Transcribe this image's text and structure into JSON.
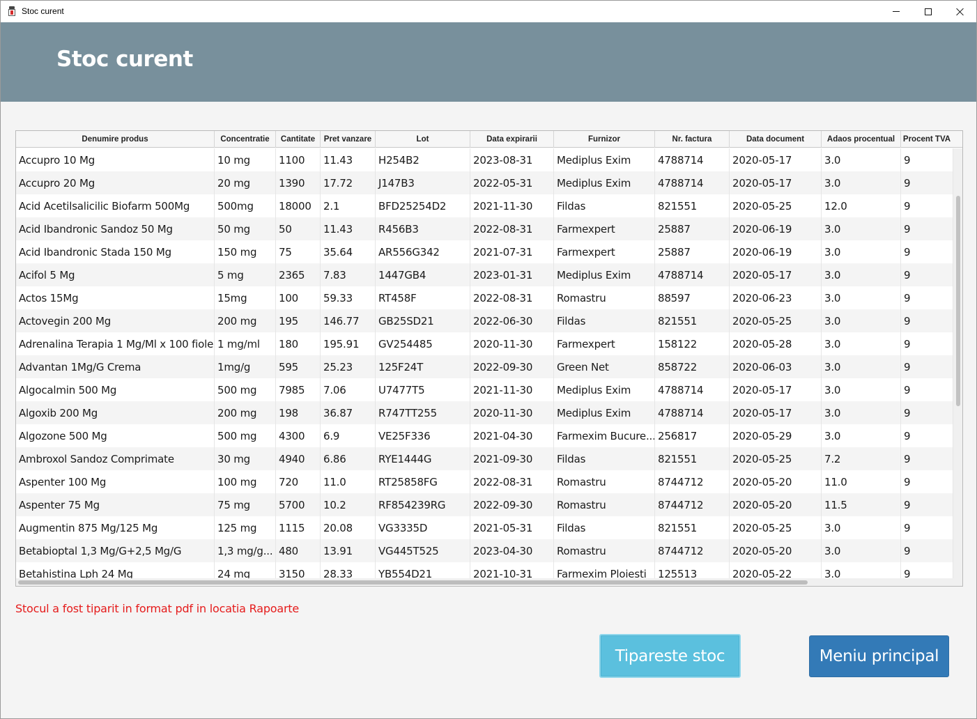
{
  "window": {
    "title": "Stoc curent"
  },
  "header": {
    "title": "Stoc curent",
    "background_color": "#78909c"
  },
  "table": {
    "columns": [
      "Denumire produs",
      "Concentratie",
      "Cantitate",
      "Pret vanzare",
      "Lot",
      "Data expirarii",
      "Furnizor",
      "Nr. factura",
      "Data document",
      "Adaos procentual",
      "Procent TVA"
    ],
    "rows": [
      [
        "Accupro 10 Mg",
        "10 mg",
        "1100",
        "11.43",
        "H254B2",
        "2023-08-31",
        "Mediplus Exim",
        "4788714",
        "2020-05-17",
        "3.0",
        "9"
      ],
      [
        "Accupro 20 Mg",
        "20 mg",
        "1390",
        "17.72",
        "J147B3",
        "2022-05-31",
        "Mediplus Exim",
        "4788714",
        "2020-05-17",
        "3.0",
        "9"
      ],
      [
        "Acid Acetilsalicilic Biofarm 500Mg",
        "500mg",
        "18000",
        "2.1",
        "BFD25254D2",
        "2021-11-30",
        "Fildas",
        "821551",
        "2020-05-25",
        "12.0",
        "9"
      ],
      [
        "Acid Ibandronic Sandoz 50 Mg",
        "50 mg",
        "50",
        "11.43",
        "R456B3",
        "2022-08-31",
        "Farmexpert",
        "25887",
        "2020-06-19",
        "3.0",
        "9"
      ],
      [
        "Acid Ibandronic Stada 150 Mg",
        "150 mg",
        "75",
        "35.64",
        "AR556G342",
        "2021-07-31",
        "Farmexpert",
        "25887",
        "2020-06-19",
        "3.0",
        "9"
      ],
      [
        "Acifol 5 Mg",
        "5 mg",
        "2365",
        "7.83",
        "1447GB4",
        "2023-01-31",
        "Mediplus Exim",
        "4788714",
        "2020-05-17",
        "3.0",
        "9"
      ],
      [
        "Actos 15Mg",
        "15mg",
        "100",
        "59.33",
        "RT458F",
        "2022-08-31",
        "Romastru",
        "88597",
        "2020-06-23",
        "3.0",
        "9"
      ],
      [
        "Actovegin 200 Mg",
        "200 mg",
        "195",
        "146.77",
        "GB25SD21",
        "2022-06-30",
        "Fildas",
        "821551",
        "2020-05-25",
        "3.0",
        "9"
      ],
      [
        "Adrenalina Terapia 1 Mg/Ml x 100 fiole",
        "1 mg/ml",
        "180",
        "195.91",
        "GV254485",
        "2020-11-30",
        "Farmexpert",
        "158122",
        "2020-05-28",
        "3.0",
        "9"
      ],
      [
        "Advantan 1Mg/G Crema",
        "1mg/g",
        "595",
        "25.23",
        "125F24T",
        "2022-09-30",
        "Green Net",
        "858722",
        "2020-06-03",
        "3.0",
        "9"
      ],
      [
        "Algocalmin 500 Mg",
        "500 mg",
        "7985",
        "7.06",
        "U7477T5",
        "2021-11-30",
        "Mediplus Exim",
        "4788714",
        "2020-05-17",
        "3.0",
        "9"
      ],
      [
        "Algoxib 200 Mg",
        "200 mg",
        "198",
        "36.87",
        "R747TT255",
        "2020-11-30",
        "Mediplus Exim",
        "4788714",
        "2020-05-17",
        "3.0",
        "9"
      ],
      [
        "Algozone 500 Mg",
        "500 mg",
        "4300",
        "6.9",
        "VE25F336",
        "2021-04-30",
        "Farmexim Bucure...",
        "256817",
        "2020-05-29",
        "3.0",
        "9"
      ],
      [
        "Ambroxol Sandoz Comprimate",
        "30 mg",
        "4940",
        "6.86",
        "RYE1444G",
        "2021-09-30",
        "Fildas",
        "821551",
        "2020-05-25",
        "7.2",
        "9"
      ],
      [
        "Aspenter 100 Mg",
        "100 mg",
        "720",
        "11.0",
        "RT25858FG",
        "2022-08-31",
        "Romastru",
        "8744712",
        "2020-05-20",
        "11.0",
        "9"
      ],
      [
        "Aspenter 75 Mg",
        "75 mg",
        "5700",
        "10.2",
        "RF854239RG",
        "2022-09-30",
        "Romastru",
        "8744712",
        "2020-05-20",
        "11.5",
        "9"
      ],
      [
        "Augmentin 875 Mg/125 Mg",
        "125 mg",
        "1115",
        "20.08",
        "VG3335D",
        "2021-05-31",
        "Fildas",
        "821551",
        "2020-05-25",
        "3.0",
        "9"
      ],
      [
        "Betabioptal 1,3 Mg/G+2,5 Mg/G",
        "1,3 mg/g...",
        "480",
        "13.91",
        "VG445T525",
        "2023-04-30",
        "Romastru",
        "8744712",
        "2020-05-20",
        "3.0",
        "9"
      ],
      [
        "Betahistina Lph 24 Mg",
        "24 mg",
        "3150",
        "28.33",
        "YB554D21",
        "2021-10-31",
        "Farmexim Ploiesti",
        "125513",
        "2020-05-22",
        "3.0",
        "9"
      ]
    ]
  },
  "status_message": "Stocul a fost tiparit in format pdf in locatia Rapoarte",
  "status_color": "#e51b1b",
  "buttons": {
    "print_label": "Tipareste stoc",
    "print_color": "#5bc0de",
    "menu_label": "Meniu principal",
    "menu_color": "#337ab7"
  }
}
